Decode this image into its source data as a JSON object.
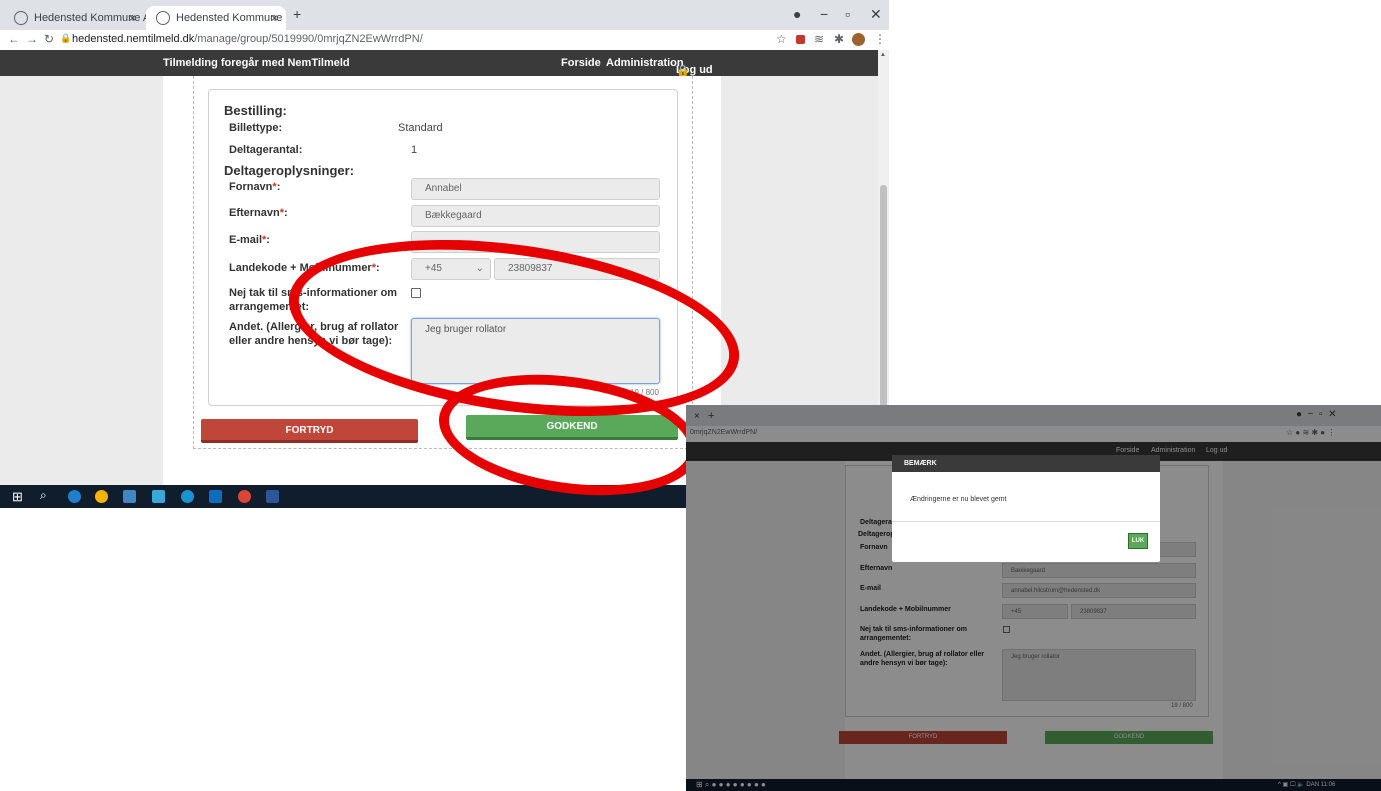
{
  "browser": {
    "tabs": [
      {
        "label": "Hedensted Kommune Administra"
      },
      {
        "label": "Hedensted Kommune"
      }
    ],
    "new_tab": "+",
    "close_tab": "×",
    "url_host": "hedensted.nemtilmeld.dk",
    "url_path": "/manage/group/5019990/0mrjqZN2EwWrrdPN/",
    "url_short": "0mrjqZN2EwWrrdPN/"
  },
  "topnav": {
    "brand": "Tilmelding foregår med NemTilmeld",
    "forside": "Forside",
    "administration": "Administration",
    "logout": "Log ud"
  },
  "form": {
    "order_heading": "Bestilling:",
    "ticket_label": "Billettype:",
    "ticket_value": "Standard",
    "count_label": "Deltagerantal:",
    "count_value": "1",
    "participant_heading": "Deltageroplysninger:",
    "firstname_label": "Fornavn",
    "firstname_value": "Annabel",
    "lastname_label": "Efternavn",
    "lastname_value": "Bækkegaard",
    "email_label": "E-mail",
    "email_value": "annabel.hilcstrom@hedensted.dk",
    "phone_label": "Landekode + Mobilnummer",
    "country_code": "+45",
    "phone_value": "23809837",
    "sms_label": "Nej tak til sms-informationer om arrangementet:",
    "other_label": "Andet. (Allergier, brug af rollator eller andre hensyn vi bør tage):",
    "other_value": "Jeg bruger rollator",
    "counter": "19 / 800",
    "required_mark": "*",
    "cancel": "FORTRYD",
    "approve": "GODKEND"
  },
  "taskbar": {
    "lang": "DAN",
    "time": "11:06",
    "date": "30-08-2021"
  },
  "modal": {
    "title": "BEMÆRK",
    "message": "Ændringerne er nu blevet gemt",
    "close": "LUK"
  },
  "colors": {
    "annotation": "#e60000",
    "approve": "#5aa95a",
    "cancel": "#c0463a"
  }
}
